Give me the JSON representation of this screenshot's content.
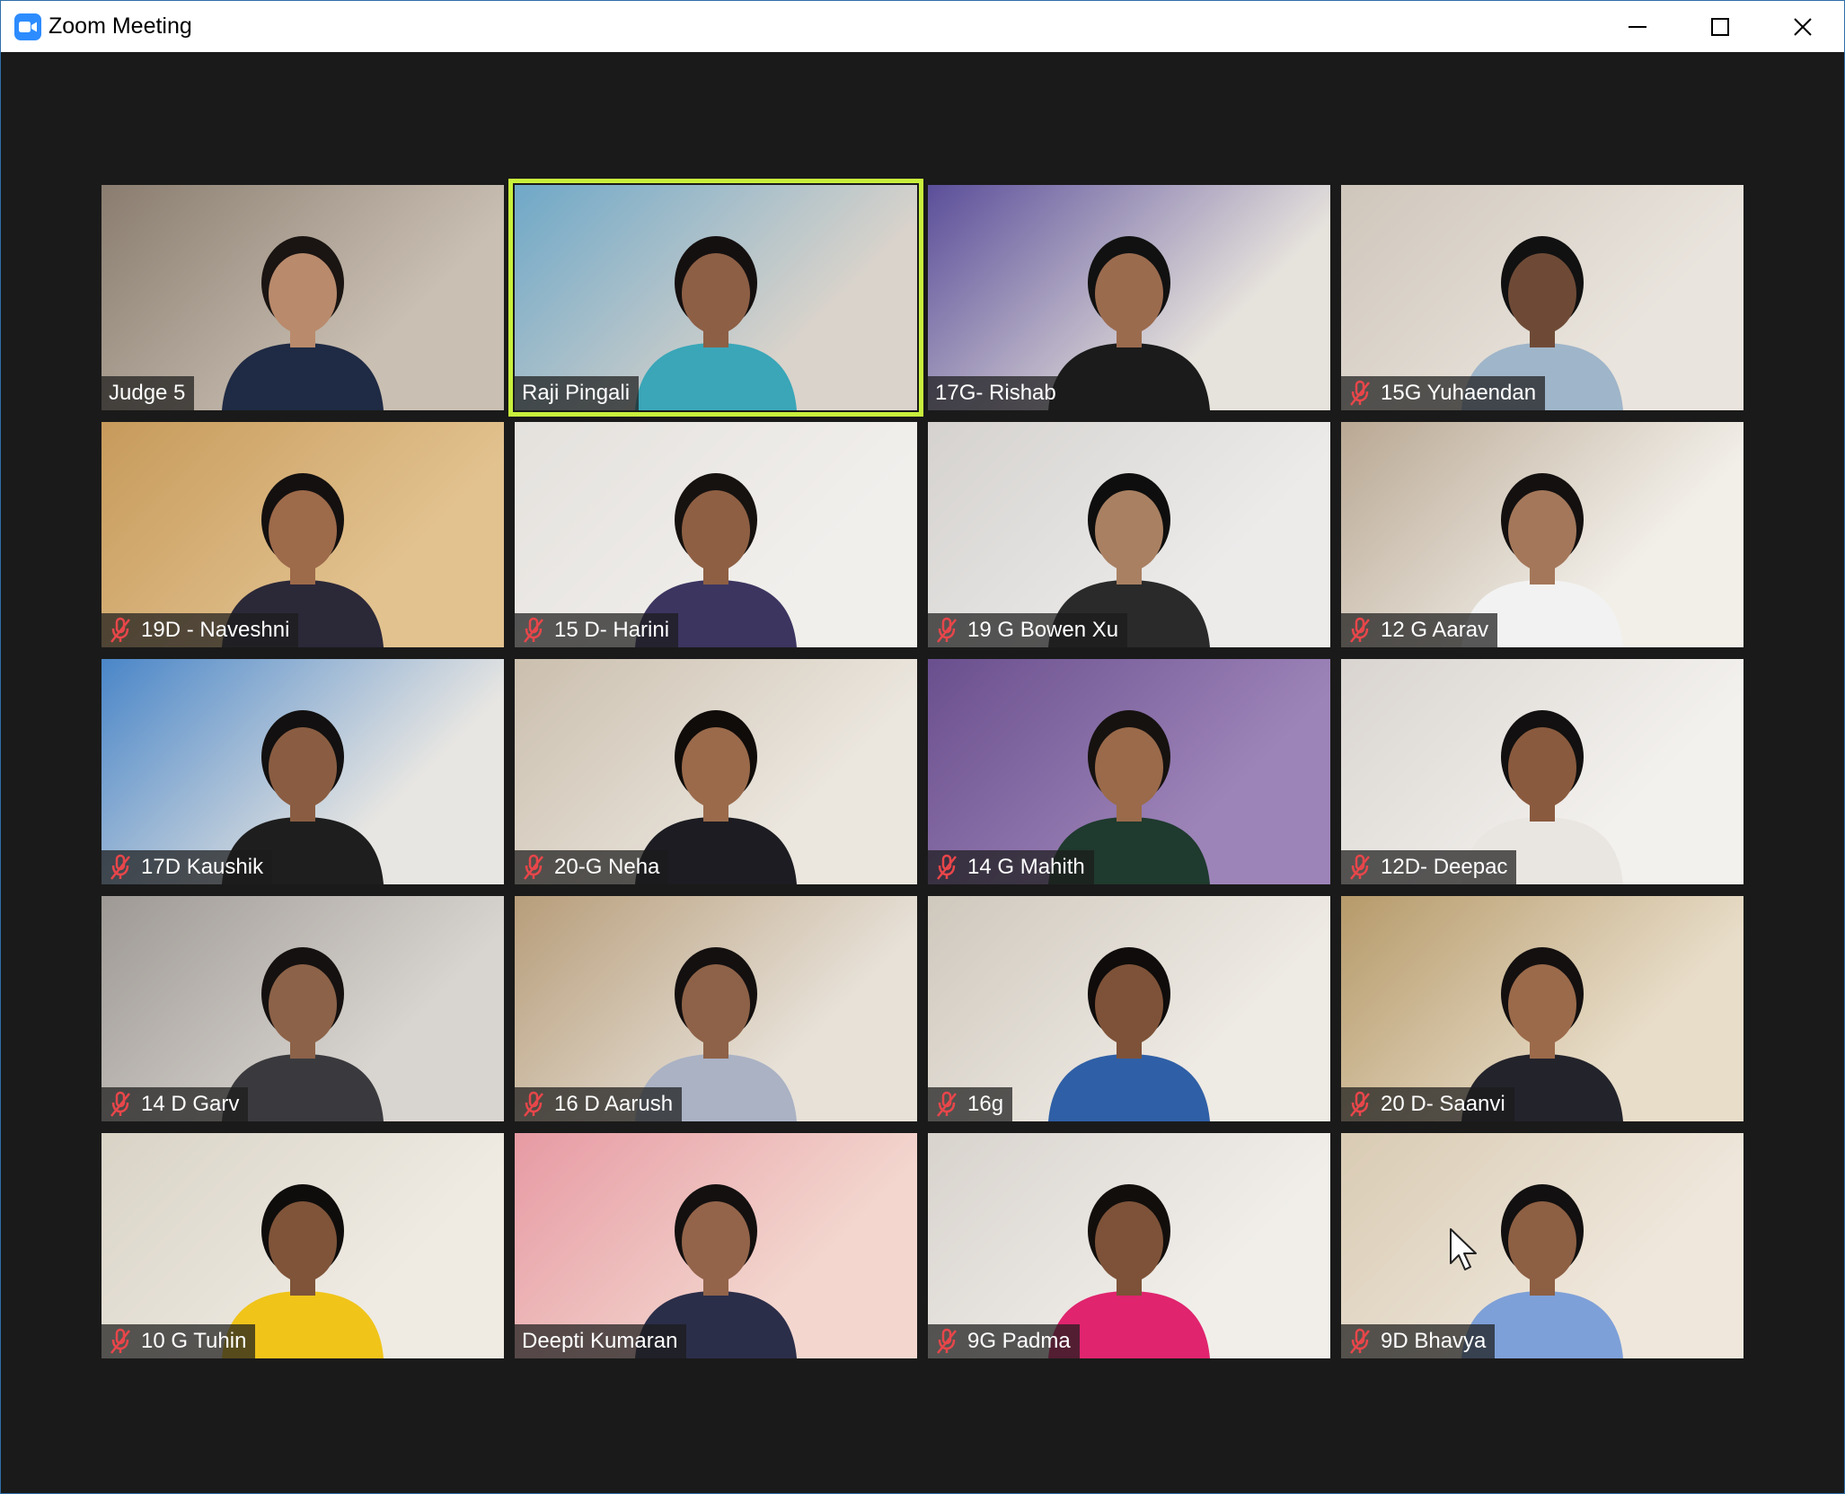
{
  "window": {
    "title": "Zoom Meeting",
    "app_icon": "zoom-camera-icon",
    "controls": [
      "minimize-icon",
      "maximize-icon",
      "close-icon"
    ]
  },
  "colors": {
    "active_speaker_border": "#c8f03c",
    "muted_icon": "#e8464a",
    "background": "#1a1a1a",
    "zoom_blue": "#2d8cff"
  },
  "participants": [
    {
      "name": "Judge 5",
      "muted": false,
      "active": false,
      "bg": [
        "#8a7d70",
        "#c9bfb2"
      ],
      "shirt": "#1f2a44",
      "skin": "#b98a6c",
      "hair": "#1a1412"
    },
    {
      "name": "Raji Pingali",
      "muted": false,
      "active": true,
      "bg": [
        "#6fa8c8",
        "#d9d3cb"
      ],
      "shirt": "#3aa6b8",
      "skin": "#8d5f45",
      "hair": "#151010"
    },
    {
      "name": "17G- Rishab",
      "muted": false,
      "active": false,
      "bg": [
        "#5b4e9a",
        "#e6e2dc"
      ],
      "shirt": "#1b1b1b",
      "skin": "#9b6b4e",
      "hair": "#111"
    },
    {
      "name": "15G Yuhaendan",
      "muted": true,
      "active": false,
      "bg": [
        "#cfc6bb",
        "#e9e4dd"
      ],
      "shirt": "#9fb5c9",
      "skin": "#6e4a36",
      "hair": "#111"
    },
    {
      "name": "19D - Naveshni",
      "muted": true,
      "active": false,
      "bg": [
        "#c79a5b",
        "#e2c28f"
      ],
      "shirt": "#2b2838",
      "skin": "#9d6a4a",
      "hair": "#141010"
    },
    {
      "name": "15 D- Harini",
      "muted": true,
      "active": false,
      "bg": [
        "#e4e1dd",
        "#f1efec"
      ],
      "shirt": "#3c3560",
      "skin": "#8e5f43",
      "hair": "#161210"
    },
    {
      "name": "19 G Bowen Xu",
      "muted": true,
      "active": false,
      "bg": [
        "#d5d2cf",
        "#ecebea"
      ],
      "shirt": "#2a2a2a",
      "skin": "#a98062",
      "hair": "#0e0e0e"
    },
    {
      "name": "12 G Aarav",
      "muted": true,
      "active": false,
      "bg": [
        "#b9a893",
        "#f2efe9"
      ],
      "shirt": "#f2f2f2",
      "skin": "#a4775a",
      "hair": "#141010"
    },
    {
      "name": "17D Kaushik",
      "muted": true,
      "active": false,
      "bg": [
        "#4a86c8",
        "#e8e6e2"
      ],
      "shirt": "#1e1e1e",
      "skin": "#8a5d42",
      "hair": "#121010"
    },
    {
      "name": "20-G Neha",
      "muted": true,
      "active": false,
      "bg": [
        "#cbbfae",
        "#ebe6de"
      ],
      "shirt": "#1c1c22",
      "skin": "#9a6a4b",
      "hair": "#100c0a"
    },
    {
      "name": "14 G Mahith",
      "muted": true,
      "active": false,
      "bg": [
        "#6a4f8e",
        "#9d84b8"
      ],
      "shirt": "#1f3a2e",
      "skin": "#9a6a4a",
      "hair": "#161210"
    },
    {
      "name": "12D- Deepac",
      "muted": true,
      "active": false,
      "bg": [
        "#d9d4cf",
        "#f3f1ee"
      ],
      "shirt": "#e9e6e2",
      "skin": "#8a5a3e",
      "hair": "#121010"
    },
    {
      "name": "14 D Garv",
      "muted": true,
      "active": false,
      "bg": [
        "#9e9994",
        "#d8d4cf"
      ],
      "shirt": "#3a3a3e",
      "skin": "#8c6248",
      "hair": "#151110"
    },
    {
      "name": "16 D Aarush",
      "muted": true,
      "active": false,
      "bg": [
        "#b79d7a",
        "#e7e1d8"
      ],
      "shirt": "#aab2c4",
      "skin": "#8e6248",
      "hair": "#141010"
    },
    {
      "name": "16g",
      "muted": true,
      "active": false,
      "bg": [
        "#cfc8bd",
        "#eeeae4"
      ],
      "shirt": "#2f5fa6",
      "skin": "#7e5238",
      "hair": "#0f0c0b"
    },
    {
      "name": "20 D- Saanvi",
      "muted": true,
      "active": false,
      "bg": [
        "#b69a6a",
        "#e8ddc9"
      ],
      "shirt": "#23232b",
      "skin": "#9b6a4a",
      "hair": "#141010"
    },
    {
      "name": "10 G Tuhin",
      "muted": true,
      "active": false,
      "bg": [
        "#d9d3c6",
        "#efebe3"
      ],
      "shirt": "#f0c419",
      "skin": "#7f5439",
      "hair": "#0f0d0c"
    },
    {
      "name": "Deepti Kumaran",
      "muted": false,
      "active": false,
      "bg": [
        "#e79aa3",
        "#f3d7cf"
      ],
      "shirt": "#2b2e49",
      "skin": "#93644a",
      "hair": "#141010"
    },
    {
      "name": "9G Padma",
      "muted": true,
      "active": false,
      "bg": [
        "#d8d3cd",
        "#f1eeea"
      ],
      "shirt": "#e0246e",
      "skin": "#7d5238",
      "hair": "#120e0c"
    },
    {
      "name": "9D Bhavya",
      "muted": true,
      "active": false,
      "bg": [
        "#d9cbb3",
        "#efe7dc"
      ],
      "shirt": "#7ea0d8",
      "skin": "#8d5f43",
      "hair": "#121010"
    }
  ]
}
